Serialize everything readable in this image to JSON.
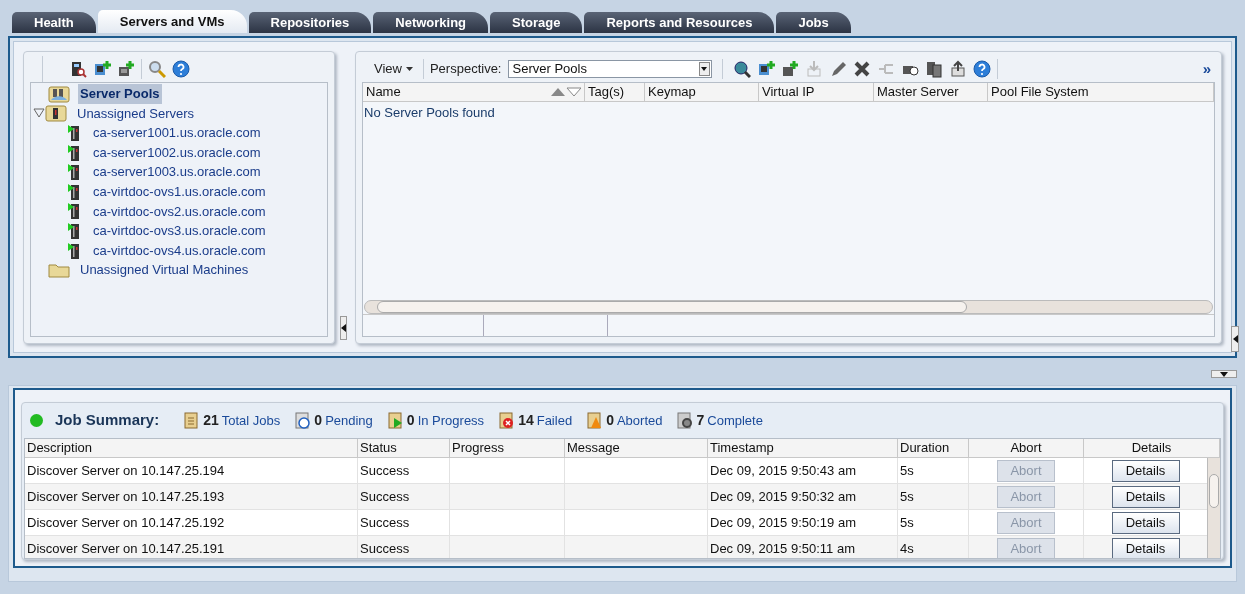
{
  "tabs": [
    {
      "label": "Health",
      "selected": false
    },
    {
      "label": "Servers and VMs",
      "selected": true
    },
    {
      "label": "Repositories",
      "selected": false
    },
    {
      "label": "Networking",
      "selected": false
    },
    {
      "label": "Storage",
      "selected": false
    },
    {
      "label": "Reports and Resources",
      "selected": false
    },
    {
      "label": "Jobs",
      "selected": false
    }
  ],
  "tree": [
    {
      "label": "Server Pools",
      "kind": "pool",
      "selected": true
    },
    {
      "label": "Unassigned Servers",
      "kind": "servers",
      "selected": false,
      "expanded": true,
      "children": [
        {
          "label": "ca-server1001.us.oracle.com",
          "kind": "server",
          "selected": false
        },
        {
          "label": "ca-server1002.us.oracle.com",
          "kind": "server",
          "selected": false
        },
        {
          "label": "ca-server1003.us.oracle.com",
          "kind": "server",
          "selected": false
        },
        {
          "label": "ca-virtdoc-ovs1.us.oracle.com",
          "kind": "server",
          "selected": false
        },
        {
          "label": "ca-virtdoc-ovs2.us.oracle.com",
          "kind": "server",
          "selected": false
        },
        {
          "label": "ca-virtdoc-ovs3.us.oracle.com",
          "kind": "server",
          "selected": false
        },
        {
          "label": "ca-virtdoc-ovs4.us.oracle.com",
          "kind": "server",
          "selected": false
        }
      ]
    },
    {
      "label": "Unassigned Virtual Machines",
      "kind": "folder",
      "selected": false
    }
  ],
  "toolbar": {
    "view_menu": "View",
    "perspective_label": "Perspective:",
    "perspective_value": "Server Pools",
    "overflow": "»"
  },
  "pools_table": {
    "columns": [
      "Name",
      "Tag(s)",
      "Keymap",
      "Virtual IP",
      "Master Server",
      "Pool File System"
    ],
    "empty_message": "No Server Pools found"
  },
  "job_summary": {
    "title": "Job Summary:",
    "color": "#22bb22",
    "counts": [
      {
        "kind": "total",
        "count": "21",
        "label": "Total Jobs"
      },
      {
        "kind": "pending",
        "count": "0",
        "label": "Pending"
      },
      {
        "kind": "progress",
        "count": "0",
        "label": "In Progress"
      },
      {
        "kind": "failed",
        "count": "14",
        "label": "Failed"
      },
      {
        "kind": "aborted",
        "count": "0",
        "label": "Aborted"
      },
      {
        "kind": "complete",
        "count": "7",
        "label": "Complete"
      }
    ]
  },
  "jobs_table": {
    "columns": [
      "Description",
      "Status",
      "Progress",
      "Message",
      "Timestamp",
      "Duration",
      "Abort",
      "Details"
    ],
    "rows": [
      {
        "description": "Discover Server on 10.147.25.194",
        "status": "Success",
        "timestamp": "Dec 09, 2015 9:50:43 am",
        "duration": "5s",
        "abort": "Abort",
        "abort_disabled": true,
        "details": "Details"
      },
      {
        "description": "Discover Server on 10.147.25.193",
        "status": "Success",
        "timestamp": "Dec 09, 2015 9:50:32 am",
        "duration": "5s",
        "abort": "Abort",
        "abort_disabled": true,
        "details": "Details"
      },
      {
        "description": "Discover Server on 10.147.25.192",
        "status": "Success",
        "timestamp": "Dec 09, 2015 9:50:19 am",
        "duration": "5s",
        "abort": "Abort",
        "abort_disabled": true,
        "details": "Details"
      },
      {
        "description": "Discover Server on 10.147.25.191",
        "status": "Success",
        "timestamp": "Dec 09, 2015 9:50:11 am",
        "duration": "4s",
        "abort": "Abort",
        "abort_disabled": true,
        "details": "Details"
      }
    ]
  }
}
